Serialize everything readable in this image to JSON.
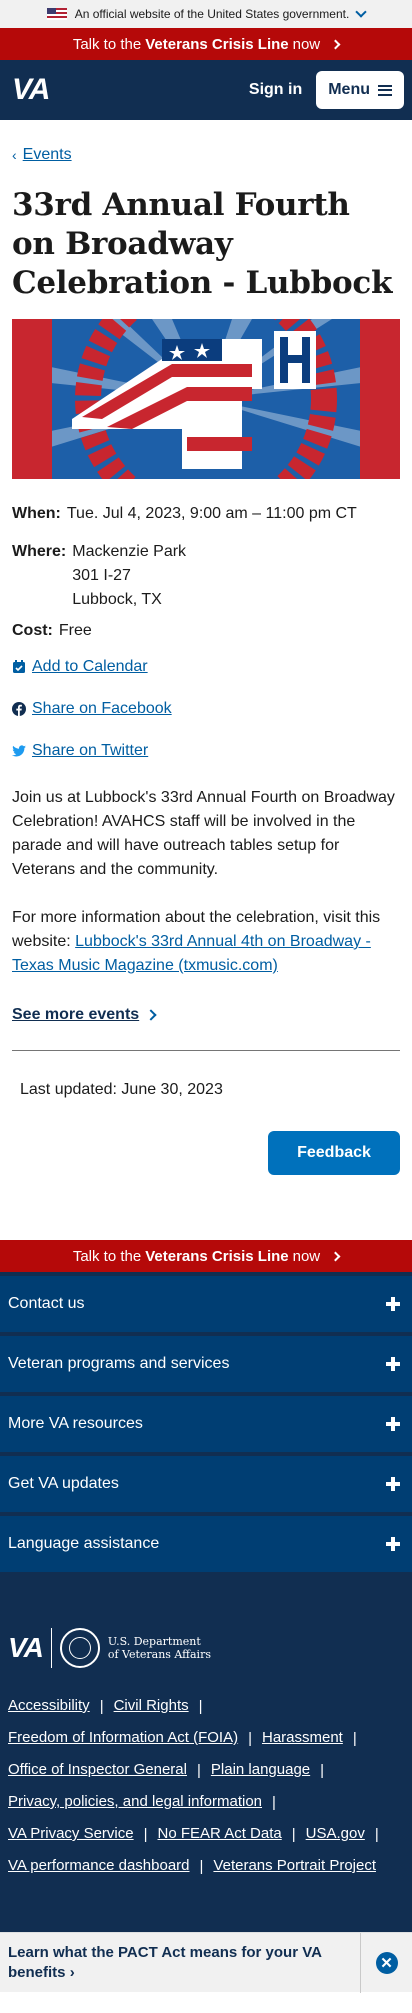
{
  "gov_banner": {
    "text": "An official website of the United States government."
  },
  "crisis_line": {
    "prefix": "Talk to the ",
    "bold": "Veterans Crisis Line",
    "suffix": " now"
  },
  "header": {
    "logo": "VA",
    "sign_in": "Sign in",
    "menu": "Menu"
  },
  "breadcrumb": {
    "label": "Events"
  },
  "event": {
    "title": "33rd Annual Fourth on Broadway Celebration - Lubbock",
    "when_label": "When:",
    "when_value": "Tue. Jul 4, 2023, 9:00 am – 11:00 pm CT",
    "where_label": "Where:",
    "where_lines": [
      "Mackenzie Park",
      "301 I-27",
      "Lubbock, TX"
    ],
    "cost_label": "Cost:",
    "cost_value": "Free"
  },
  "actions": {
    "calendar": "Add to Calendar",
    "facebook": "Share on Facebook",
    "twitter": "Share on Twitter"
  },
  "description": {
    "p1": "Join us at Lubbock's 33rd Annual Fourth on Broadway Celebration! AVAHCS staff will be involved in the parade and will have outreach tables setup for Veterans and the community.",
    "p2_prefix": "For more information about the celebration, visit this website: ",
    "p2_link": "Lubbock's 33rd Annual 4th on Broadway - Texas Music Magazine (txmusic.com)"
  },
  "see_more": "See more events",
  "last_updated": "Last updated: June 30, 2023",
  "feedback": "Feedback",
  "footer": {
    "accordion": [
      "Contact us",
      "Veteran programs and services",
      "More VA resources",
      "Get VA updates",
      "Language assistance"
    ],
    "logo_va": "VA",
    "dept_line1": "U.S. Department",
    "dept_line2": "of Veterans Affairs",
    "links": [
      "Accessibility",
      "Civil Rights",
      "Freedom of Information Act (FOIA)",
      "Harassment",
      "Office of Inspector General",
      "Plain language",
      "Privacy, policies, and legal information",
      "VA Privacy Service",
      "No FEAR Act Data",
      "USA.gov",
      "VA performance dashboard",
      "Veterans Portrait Project"
    ]
  },
  "pact_banner": {
    "text": "Learn what the PACT Act means for your VA benefits"
  },
  "colors": {
    "crisis": "#b50909",
    "header": "#112e51",
    "accordion": "#003e73",
    "link": "#005ea2",
    "button": "#0071bc"
  }
}
